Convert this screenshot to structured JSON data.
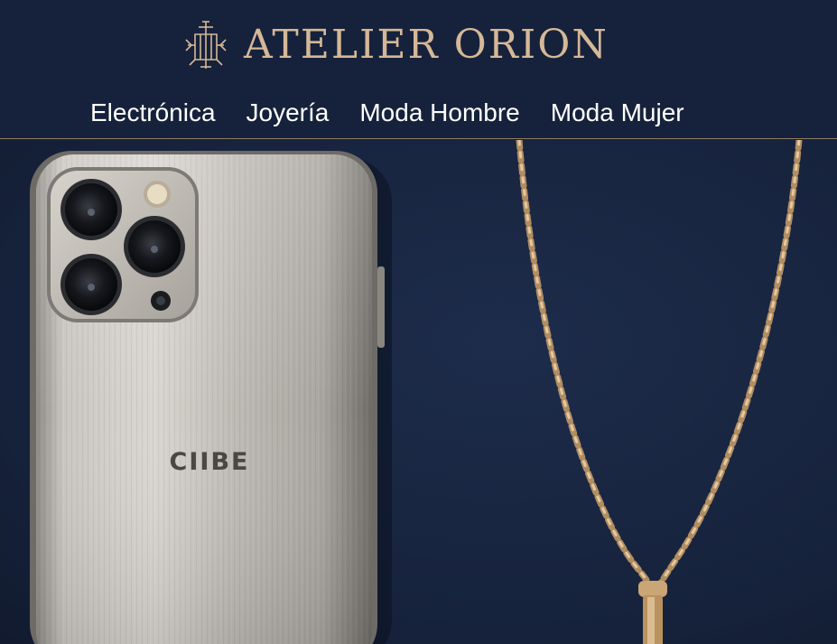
{
  "header": {
    "brand_name": "ATELIER ORION",
    "logo_icon": "atelier-orion-monogram-icon"
  },
  "nav": {
    "items": [
      {
        "label": "Electrónica"
      },
      {
        "label": "Joyería"
      },
      {
        "label": "Moda Hombre"
      },
      {
        "label": "Moda Mujer"
      }
    ]
  },
  "hero": {
    "phone_brand_text": "CIIBE",
    "image_subject": "phone-and-gold-necklace"
  },
  "colors": {
    "header_bg": "#16223b",
    "brand_gold": "#d5b897",
    "nav_text": "#ffffff"
  }
}
